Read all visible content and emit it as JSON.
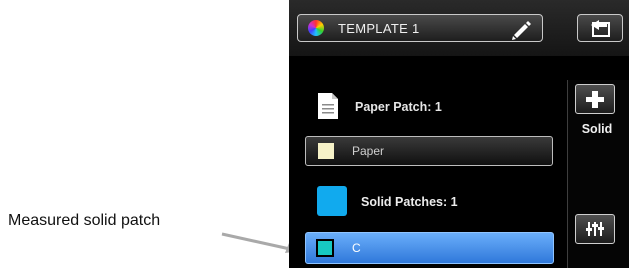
{
  "callout": {
    "text": "Measured solid patch"
  },
  "header": {
    "template_name": "TEMPLATE 1",
    "color_icon": "color-wheel-icon",
    "edit_icon": "pencil-icon",
    "back_icon": "back-icon"
  },
  "paper_section": {
    "icon": "document-icon",
    "label": "Paper Patch: 1",
    "item": {
      "label": "Paper",
      "swatch_color": "#f6f2c8"
    }
  },
  "solid_section": {
    "icon": "solid-patch-icon",
    "icon_color": "#11aaee",
    "label": "Solid Patches: 1",
    "item": {
      "label": "C",
      "swatch_color": "#17c9c1",
      "selected": true
    }
  },
  "side_panel": {
    "add_icon": "plus-icon",
    "add_label": "Solid",
    "settings_icon": "sliders-icon"
  }
}
